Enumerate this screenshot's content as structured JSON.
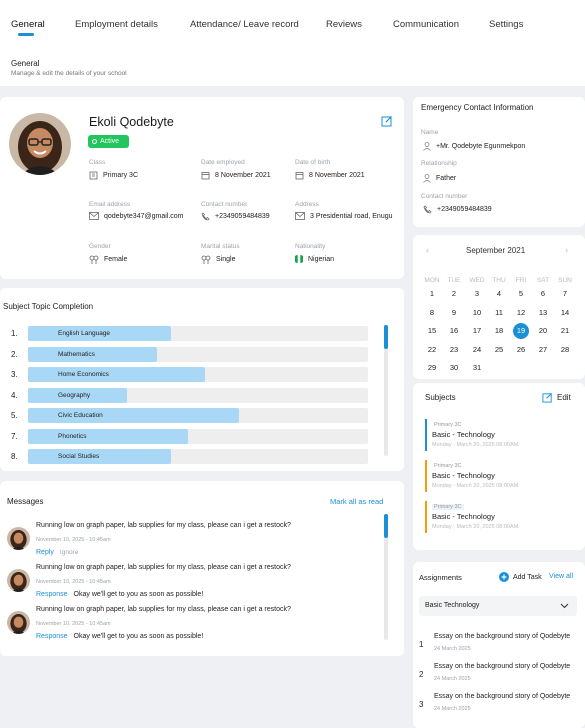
{
  "tabs": [
    {
      "label": "General",
      "active": true
    },
    {
      "label": "Employment details"
    },
    {
      "label": "Attendance/ Leave record"
    },
    {
      "label": "Reviews"
    },
    {
      "label": "Communication"
    },
    {
      "label": "Settings"
    }
  ],
  "section": {
    "title": "General",
    "subtitle": "Manage & edit the details of your school"
  },
  "profile": {
    "name": "Ekoli Qodebyte",
    "status": "Active",
    "fields": {
      "class": {
        "label": "Class",
        "value": "Primary 3C"
      },
      "date_employed": {
        "label": "Date employed",
        "value": "8 November 2021"
      },
      "dob": {
        "label": "Date of birth",
        "value": "8 November 2021"
      },
      "email": {
        "label": "Email address",
        "value": "qodebyte347@gmail.com"
      },
      "contact": {
        "label": "Contact number",
        "value": "+2349059484839"
      },
      "address": {
        "label": "Address",
        "value": "3 Presidential road, Enugu"
      },
      "gender": {
        "label": "Gender",
        "value": "Female"
      },
      "marital": {
        "label": "Marital status",
        "value": "Single"
      },
      "nationality": {
        "label": "Nationality",
        "value": "Nigerian"
      }
    }
  },
  "subject_topic": {
    "title": "Subject Topic Completion",
    "items": [
      {
        "num": "1.",
        "name": "English Language",
        "progress": 0.42
      },
      {
        "num": "2.",
        "name": "Mathematics",
        "progress": 0.38
      },
      {
        "num": "3.",
        "name": "Home Economics",
        "progress": 0.52
      },
      {
        "num": "4.",
        "name": "Geography",
        "progress": 0.29
      },
      {
        "num": "5.",
        "name": "Civic Education",
        "progress": 0.62
      },
      {
        "num": "7.",
        "name": "Phonetics",
        "progress": 0.47
      },
      {
        "num": "8.",
        "name": "Social Studies",
        "progress": 0.42
      }
    ]
  },
  "messages": {
    "title": "Messages",
    "mark_all": "Mark all as read",
    "items": [
      {
        "text": "Running low on graph paper, lab supplies for my class, please can i get a restock?",
        "time": "November 10, 2025 - 10:45am",
        "action": "Reply",
        "secondary": "Ignore"
      },
      {
        "text": "Running low on graph paper, lab supplies for my class, please can i get a restock?",
        "time": "November 10, 2025 - 10:45am",
        "action": "Response",
        "secondary": "Okay we'll get to you as soon as possible!"
      },
      {
        "text": "Running low on graph paper, lab supplies for my class, please can i get a restock?",
        "time": "November 10, 2025 - 10:45am",
        "action": "Response",
        "secondary": "Okay we'll get to you as soon as possible!"
      }
    ]
  },
  "emergency": {
    "title": "Emergency Contact Information",
    "name_label": "Name",
    "name_value": "+Mr. Qodebyte Egunmekpon",
    "rel_label": "Relationship",
    "rel_value": "Father",
    "contact_label": "Contact number",
    "contact_value": "+2349059484839"
  },
  "calendar": {
    "month": "September 2021",
    "prev": "‹",
    "next": "›",
    "dow": [
      "MON",
      "TUE",
      "WED",
      "THU",
      "FRI",
      "SAT",
      "SUN"
    ],
    "weeks": [
      [
        "1",
        "2",
        "3",
        "4",
        "5",
        "6",
        "7"
      ],
      [
        "8",
        "9",
        "10",
        "11",
        "12",
        "13",
        "14"
      ],
      [
        "15",
        "16",
        "17",
        "18",
        "19",
        "20",
        "21"
      ],
      [
        "22",
        "23",
        "24",
        "25",
        "26",
        "27",
        "28"
      ],
      [
        "29",
        "30",
        "31",
        "",
        "",
        "",
        ""
      ]
    ],
    "selected": "19"
  },
  "subjects": {
    "title": "Subjects",
    "edit": "Edit",
    "items": [
      {
        "tag": "Primary 3C",
        "name": "Basic - Technology",
        "date": "Monday - March 20, 2025 08:00AM",
        "color": "#1d8fd6"
      },
      {
        "tag": "Primary 3C",
        "name": "Basic - Technology",
        "date": "Monday - March 20, 2025 08:00AM",
        "color": "#f59e0b"
      },
      {
        "tag": "Primary 3C",
        "name": "Basic - Technology",
        "date": "Monday - March 20, 2025 08:00AM",
        "color": "#f59e0b"
      }
    ]
  },
  "assignments": {
    "title": "Assignments",
    "add": "Add Task",
    "view_all": "View all",
    "select": "Basic Technology",
    "items": [
      {
        "num": "1",
        "name": "Essay on the background story of Qodebyte",
        "date": "24 March 2025"
      },
      {
        "num": "2",
        "name": "Essay on the background story of Qodebyte",
        "date": "24 March 2025"
      },
      {
        "num": "3",
        "name": "Essay on the background story of Qodebyte",
        "date": "24 March 2025"
      }
    ]
  }
}
